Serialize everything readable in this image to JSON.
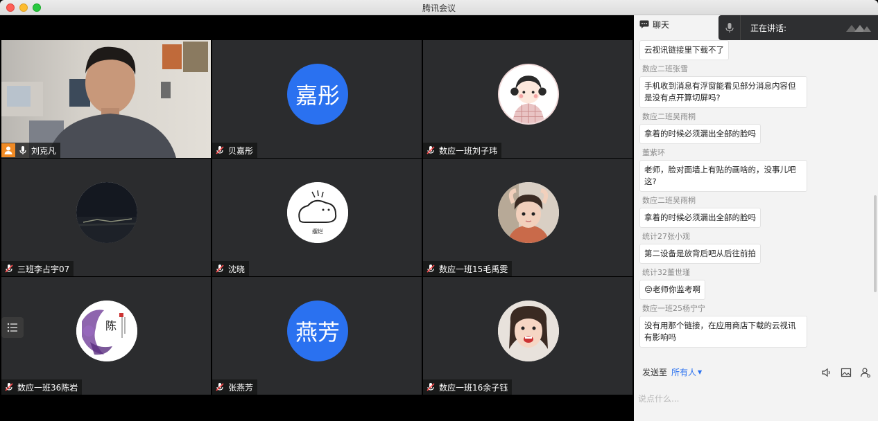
{
  "window": {
    "title": "腾讯会议"
  },
  "participants": [
    {
      "name": "刘克凡",
      "type": "camera",
      "host": true
    },
    {
      "name": "贝嘉彤",
      "type": "text",
      "avatar_text": "嘉彤"
    },
    {
      "name": "数应一班刘子玮",
      "type": "image",
      "avatar_icon": "cartoon-girl-icon"
    },
    {
      "name": "三班李占宇07",
      "type": "image",
      "avatar_icon": "night-sky-icon"
    },
    {
      "name": "沈晓",
      "type": "image",
      "avatar_icon": "lying-cartoon-icon",
      "avatar_caption": "摆烂"
    },
    {
      "name": "数应一班15毛禹雯",
      "type": "image",
      "avatar_icon": "child-photo-icon"
    },
    {
      "name": "数应一班36陈岩",
      "type": "image",
      "avatar_icon": "purple-seal-icon",
      "avatar_text": "陈"
    },
    {
      "name": "张燕芳",
      "type": "text",
      "avatar_text": "燕芳"
    },
    {
      "name": "数应一班16余子钰",
      "type": "image",
      "avatar_icon": "smiling-girl-icon"
    }
  ],
  "chat": {
    "header": "聊天",
    "speaking_label": "正在讲话:",
    "messages": [
      {
        "sender": "",
        "text": "云视讯链接里下载不了"
      },
      {
        "sender": "数应二班张雪",
        "text": "手机收到消息有浮窗能看见部分消息内容但是没有点开算切屏吗?"
      },
      {
        "sender": "数应二班吴雨桐",
        "text": "拿着的时候必须漏出全部的脸吗"
      },
      {
        "sender": "董紫环",
        "text": "老师，脸对面墙上有贴的画啥的，没事儿吧这?"
      },
      {
        "sender": "数应二班吴雨桐",
        "text": "拿着的时候必须漏出全部的脸吗"
      },
      {
        "sender": "统计27张小观",
        "text": "第二设备是放背后吧从后往前拍"
      },
      {
        "sender": "统计32董世瑾",
        "text": "😔老师你监考啊"
      },
      {
        "sender": "数应一班25杨宁宁",
        "text": "没有用那个链接，在应用商店下载的云视讯有影响吗"
      }
    ],
    "send_to_label": "发送至",
    "send_to_target": "所有人",
    "input_placeholder": "说点什么..."
  },
  "colors": {
    "accent": "#2a71f0",
    "host_badge": "#f08a24",
    "tile_bg": "#2b2c2e"
  }
}
